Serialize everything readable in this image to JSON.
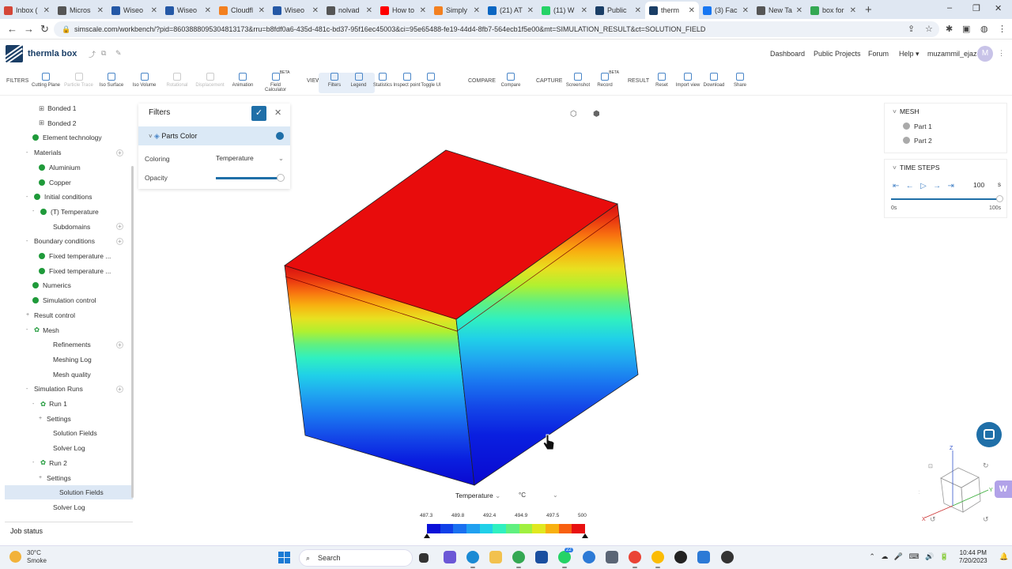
{
  "browser": {
    "tabs": [
      {
        "title": "Inbox (",
        "favicon_color": "#d44638"
      },
      {
        "title": "Micros",
        "favicon_color": "#555555"
      },
      {
        "title": "Wiseo",
        "favicon_color": "#2458a6"
      },
      {
        "title": "Wiseo",
        "favicon_color": "#2458a6"
      },
      {
        "title": "Cloudfl",
        "favicon_color": "#f38020"
      },
      {
        "title": "Wiseo",
        "favicon_color": "#2458a6"
      },
      {
        "title": "nolvad",
        "favicon_color": "#555555"
      },
      {
        "title": "How to",
        "favicon_color": "#ff0000"
      },
      {
        "title": "Simply",
        "favicon_color": "#f38020"
      },
      {
        "title": "(21) AT",
        "favicon_color": "#0a66c2"
      },
      {
        "title": "(11) W",
        "favicon_color": "#25d366"
      },
      {
        "title": "Public",
        "favicon_color": "#1a3e66"
      },
      {
        "title": "therm",
        "favicon_color": "#1a3e66",
        "active": true
      },
      {
        "title": "(3) Fac",
        "favicon_color": "#1877f2"
      },
      {
        "title": "New Ta",
        "favicon_color": "#555555"
      },
      {
        "title": "box for",
        "favicon_color": "#34a853"
      }
    ],
    "new_tab": "+",
    "url": "simscale.com/workbench/?pid=8603888095304813173&rru=b8fdf0a6-435d-481c-bd37-95f16ec45003&ci=95e65488-fe19-44d4-8fb7-564ecb1f5e00&mt=SIMULATION_RESULT&ct=SOLUTION_FIELD"
  },
  "app": {
    "project_name": "thermla box",
    "nav": [
      "Dashboard",
      "Public Projects",
      "Forum",
      "Help"
    ],
    "username": "muzammil_ejaz",
    "avatar_letter": "M"
  },
  "toolbar": {
    "sections": {
      "filters": "FILTERS",
      "view": "VIEW",
      "compare": "COMPARE",
      "capture": "CAPTURE",
      "result": "RESULT"
    },
    "filters_buttons": [
      {
        "label": "Cutting Plane",
        "enabled": true
      },
      {
        "label": "Particle Trace",
        "enabled": false
      },
      {
        "label": "Iso Surface",
        "enabled": true
      },
      {
        "label": "Iso Volume",
        "enabled": true
      },
      {
        "label": "Rotational",
        "enabled": false
      },
      {
        "label": "Displacement",
        "enabled": false
      },
      {
        "label": "Animation",
        "enabled": true
      },
      {
        "label": "Field Calculator",
        "enabled": true,
        "badge": "BETA"
      }
    ],
    "view_buttons": [
      {
        "label": "Filters",
        "selected": true
      },
      {
        "label": "Legend",
        "selected": true
      },
      {
        "label": "Statistics"
      },
      {
        "label": "Inspect point"
      },
      {
        "label": "Toggle UI"
      }
    ],
    "compare_buttons": [
      {
        "label": "Compare"
      }
    ],
    "capture_buttons": [
      {
        "label": "Screenshot"
      },
      {
        "label": "Record",
        "badge": "BETA"
      }
    ],
    "result_buttons": [
      {
        "label": "Reset"
      },
      {
        "label": "Import view"
      },
      {
        "label": "Download"
      },
      {
        "label": "Share"
      }
    ]
  },
  "tree": [
    {
      "label": "Bonded 1",
      "indent": 2,
      "icon": "contact"
    },
    {
      "label": "Bonded 2",
      "indent": 2,
      "icon": "contact"
    },
    {
      "label": "Element technology",
      "indent": 1,
      "icon": "check"
    },
    {
      "label": "Materials",
      "indent": 0,
      "toggle": "-",
      "plus": true
    },
    {
      "label": "Aluminium",
      "indent": 2,
      "icon": "check"
    },
    {
      "label": "Copper",
      "indent": 2,
      "icon": "check"
    },
    {
      "label": "Initial conditions",
      "indent": 0,
      "toggle": "-",
      "icon": "check"
    },
    {
      "label": "(T) Temperature",
      "indent": 1,
      "toggle": "-",
      "icon": "check"
    },
    {
      "label": "Subdomains",
      "indent": 3,
      "plus": true
    },
    {
      "label": "Boundary conditions",
      "indent": 0,
      "toggle": "-",
      "plus": true
    },
    {
      "label": "Fixed temperature ...",
      "indent": 2,
      "icon": "check"
    },
    {
      "label": "Fixed temperature ...",
      "indent": 2,
      "icon": "check"
    },
    {
      "label": "Numerics",
      "indent": 1,
      "icon": "check"
    },
    {
      "label": "Simulation control",
      "indent": 1,
      "icon": "check"
    },
    {
      "label": "Result control",
      "indent": 0,
      "toggle": "+"
    },
    {
      "label": "Mesh",
      "indent": 0,
      "toggle": "-",
      "icon": "gear"
    },
    {
      "label": "Refinements",
      "indent": 3,
      "plus": true
    },
    {
      "label": "Meshing Log",
      "indent": 3
    },
    {
      "label": "Mesh quality",
      "indent": 3
    },
    {
      "label": "Simulation Runs",
      "indent": 0,
      "toggle": "-",
      "plus": true
    },
    {
      "label": "Run 1",
      "indent": 1,
      "toggle": "-",
      "icon": "gear"
    },
    {
      "label": "Settings",
      "indent": 2,
      "toggle": "+"
    },
    {
      "label": "Solution Fields",
      "indent": 3
    },
    {
      "label": "Solver Log",
      "indent": 3
    },
    {
      "label": "Run 2",
      "indent": 1,
      "toggle": "-",
      "icon": "gear"
    },
    {
      "label": "Settings",
      "indent": 2,
      "toggle": "+"
    },
    {
      "label": "Solution Fields",
      "indent": 3,
      "selected": true
    },
    {
      "label": "Solver Log",
      "indent": 3
    }
  ],
  "job_status": "Job status",
  "filters_panel": {
    "title": "Filters",
    "parts_color": "Parts Color",
    "coloring_label": "Coloring",
    "coloring_value": "Temperature",
    "opacity_label": "Opacity",
    "opacity_value": 0.95
  },
  "mesh_panel": {
    "title": "MESH",
    "parts": [
      "Part 1",
      "Part 2"
    ]
  },
  "time_panel": {
    "title": "TIME STEPS",
    "value": "100",
    "unit": "s",
    "start": "0s",
    "end": "100s",
    "progress": 1.0
  },
  "legend": {
    "title": "Temperature",
    "unit": "°C",
    "ticks": [
      "487.3",
      "489.8",
      "492.4",
      "494.9",
      "497.5",
      "500"
    ],
    "colors": [
      "#0a10d8",
      "#1040e8",
      "#1a70f0",
      "#20a0f0",
      "#20d0e8",
      "#30f0c0",
      "#60f080",
      "#a0f040",
      "#e0e820",
      "#f8b010",
      "#f86010",
      "#e81010"
    ]
  },
  "taskbar": {
    "temperature": "30°C",
    "weather": "Smoke",
    "search": "Search",
    "time": "10:44 PM",
    "date": "7/20/2023",
    "badge": "22"
  }
}
